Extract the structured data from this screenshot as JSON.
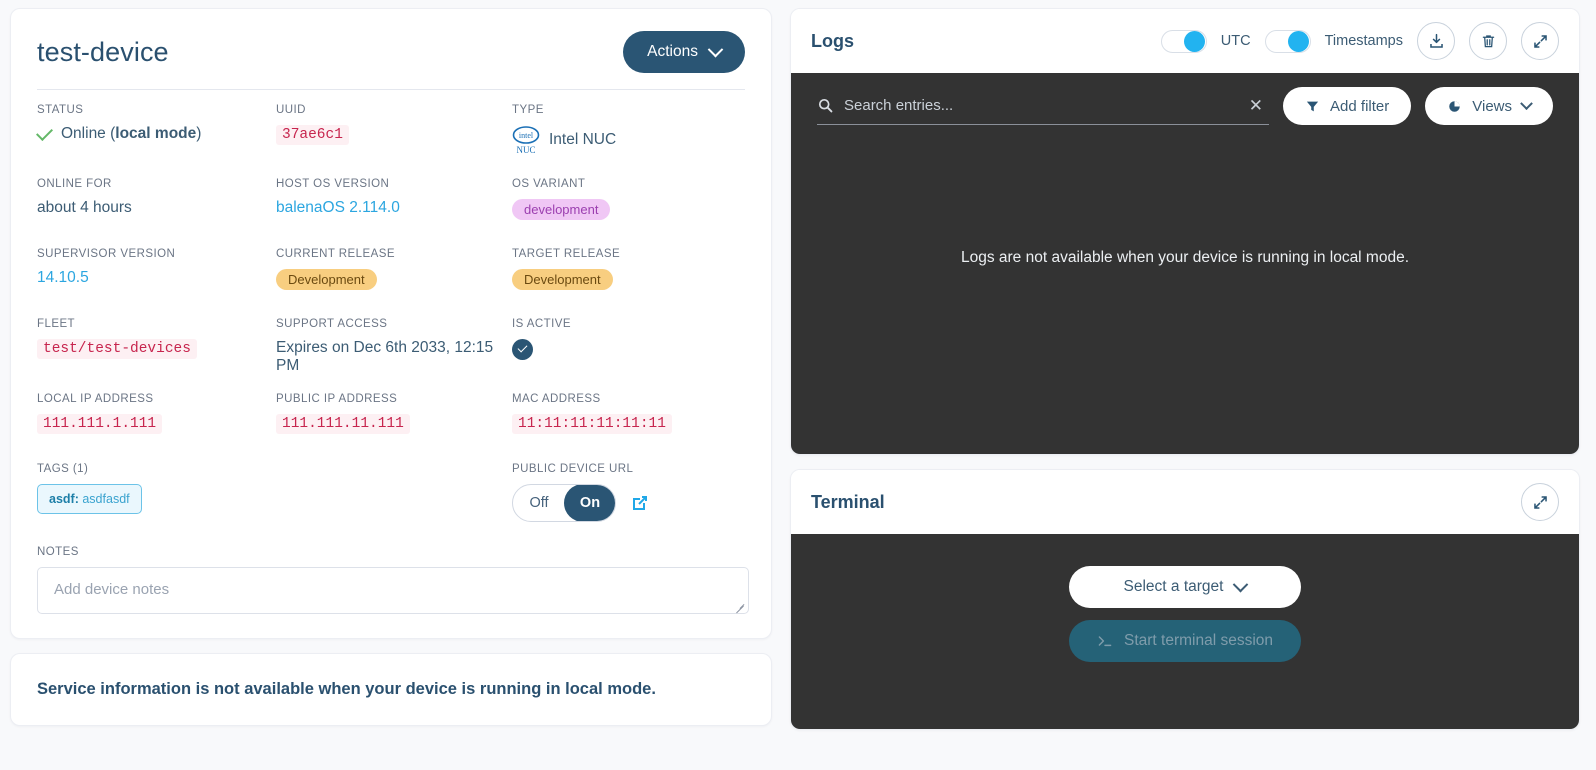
{
  "device": {
    "name": "test-device",
    "actions_label": "Actions",
    "fields": {
      "status": {
        "label": "STATUS",
        "value_prefix": "Online (",
        "value_bold": "local mode",
        "value_suffix": ")"
      },
      "uuid": {
        "label": "UUID",
        "value": "37ae6c1"
      },
      "type": {
        "label": "TYPE",
        "value": "Intel NUC",
        "logo_top": "intel",
        "logo_bottom": "NUC"
      },
      "online_for": {
        "label": "ONLINE FOR",
        "value": "about 4 hours"
      },
      "host_os_version": {
        "label": "HOST OS VERSION",
        "value": "balenaOS 2.114.0"
      },
      "os_variant": {
        "label": "OS VARIANT",
        "value": "development"
      },
      "supervisor_version": {
        "label": "SUPERVISOR VERSION",
        "value": "14.10.5"
      },
      "current_release": {
        "label": "CURRENT RELEASE",
        "value": "Development"
      },
      "target_release": {
        "label": "TARGET RELEASE",
        "value": "Development"
      },
      "fleet": {
        "label": "FLEET",
        "value": "test/test-devices"
      },
      "support_access": {
        "label": "SUPPORT ACCESS",
        "value": "Expires on Dec 6th 2033, 12:15 PM"
      },
      "is_active": {
        "label": "IS ACTIVE",
        "value": "checked"
      },
      "local_ip": {
        "label": "LOCAL IP ADDRESS",
        "value": "111.111.1.111"
      },
      "public_ip": {
        "label": "PUBLIC IP ADDRESS",
        "value": "111.111.11.111"
      },
      "mac_address": {
        "label": "MAC ADDRESS",
        "value": "11:11:11:11:11:11"
      },
      "tags": {
        "label": "TAGS (1)",
        "chip_key": "asdf:",
        "chip_value": "asdfasdf"
      },
      "public_device_url": {
        "label": "PUBLIC DEVICE URL",
        "off_label": "Off",
        "on_label": "On",
        "selected": "On"
      }
    },
    "notes": {
      "label": "NOTES",
      "placeholder": "Add device notes",
      "value": ""
    }
  },
  "service_message": "Service information is not available when your device is running in local mode.",
  "logs": {
    "title": "Logs",
    "utc_label": "UTC",
    "utc_enabled": true,
    "timestamps_label": "Timestamps",
    "timestamps_enabled": true,
    "search_placeholder": "Search entries...",
    "search_value": "",
    "add_filter_label": "Add filter",
    "views_label": "Views",
    "empty_message": "Logs are not available when your device is running in local mode."
  },
  "terminal": {
    "title": "Terminal",
    "select_target_label": "Select a target",
    "start_session_label": "Start terminal session",
    "start_session_enabled": false
  },
  "colors": {
    "accent_navy": "#2a5574",
    "link_blue": "#2ca6e0",
    "toggle_cyan": "#22b3f0",
    "mono_red": "#c7254e",
    "release_amber": "#f8ce80",
    "variant_purple": "#f0c7f5",
    "panel_dark": "#333333",
    "terminal_teal": "#256277",
    "page_bg": "#f8f9fb"
  }
}
